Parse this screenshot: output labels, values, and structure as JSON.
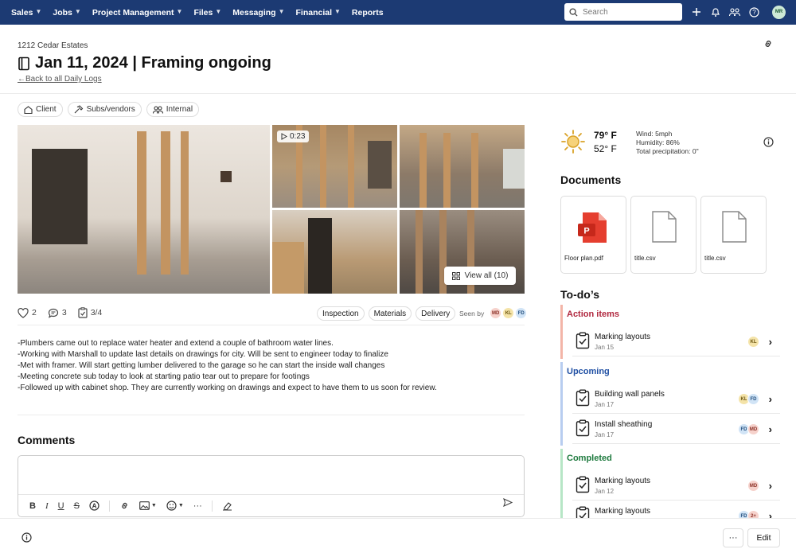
{
  "nav": {
    "items": [
      "Sales",
      "Jobs",
      "Project Management",
      "Files",
      "Messaging",
      "Financial",
      "Reports"
    ],
    "search_placeholder": "Search",
    "user_initials": "MR"
  },
  "header": {
    "breadcrumb": "1212 Cedar Estates",
    "title": "Jan 11, 2024 | Framing ongoing",
    "back_link": "←Back to all Daily Logs"
  },
  "audience": [
    "Client",
    "Subs/vendors",
    "Internal"
  ],
  "media": {
    "video_duration": "0:23",
    "view_all": "View all (10)"
  },
  "reactions": {
    "likes": "2",
    "comments": "3",
    "checklist": "3/4"
  },
  "tags": [
    "Inspection",
    "Materials",
    "Delivery"
  ],
  "seen_by": {
    "label": "Seen by",
    "users": [
      "MD",
      "KL",
      "FD"
    ]
  },
  "notes": [
    "-Plumbers came out to replace water heater and extend a couple of bathroom water lines.",
    "-Working with Marshall to update last details on drawings for city. Will be sent to engineer today to finalize",
    "-Met with framer. Will start getting lumber delivered to the garage so he can start the inside wall changes",
    "-Meeting concrete sub today to look at starting patio tear out to prepare for footings",
    "-Followed up with cabinet shop. They are currently working on drawings and expect to have them to us soon for review."
  ],
  "comments": {
    "heading": "Comments"
  },
  "footer": {
    "more": "···",
    "edit": "Edit"
  },
  "weather": {
    "high": "79° F",
    "low": "52° F",
    "wind": "Wind: 5mph",
    "humidity": "Humidity: 86%",
    "precip": "Total precipitation: 0\""
  },
  "documents": {
    "heading": "Documents",
    "files": [
      "Floor plan.pdf",
      "title.csv",
      "title.csv"
    ]
  },
  "todos": {
    "heading": "To-do’s",
    "groups": [
      {
        "title": "Action items",
        "color": "#b0273e",
        "bar": "#f3b5a8",
        "items": [
          {
            "name": "Marking layouts",
            "date": "Jan 15",
            "users": [
              "KL"
            ]
          }
        ]
      },
      {
        "title": "Upcoming",
        "color": "#1f4fa3",
        "bar": "#b8cdf0",
        "items": [
          {
            "name": "Building wall panels",
            "date": "Jan 17",
            "users": [
              "KL",
              "FD"
            ]
          },
          {
            "name": "Install sheathing",
            "date": "Jan 17",
            "users": [
              "FD",
              "MD"
            ]
          }
        ]
      },
      {
        "title": "Completed",
        "color": "#1e7a3e",
        "bar": "#b7e6c6",
        "items": [
          {
            "name": "Marking layouts",
            "date": "Jan 12",
            "users": [
              "MD"
            ]
          },
          {
            "name": "Marking layouts",
            "date": "",
            "users": [
              "FD",
              "2+"
            ]
          }
        ]
      }
    ]
  },
  "avatar_colors": {
    "MD": "#f6d2cc",
    "KL": "#f4e3a8",
    "FD": "#d1e4f6",
    "2+": "#f6d2cc",
    "MR": "#cde9d6"
  }
}
